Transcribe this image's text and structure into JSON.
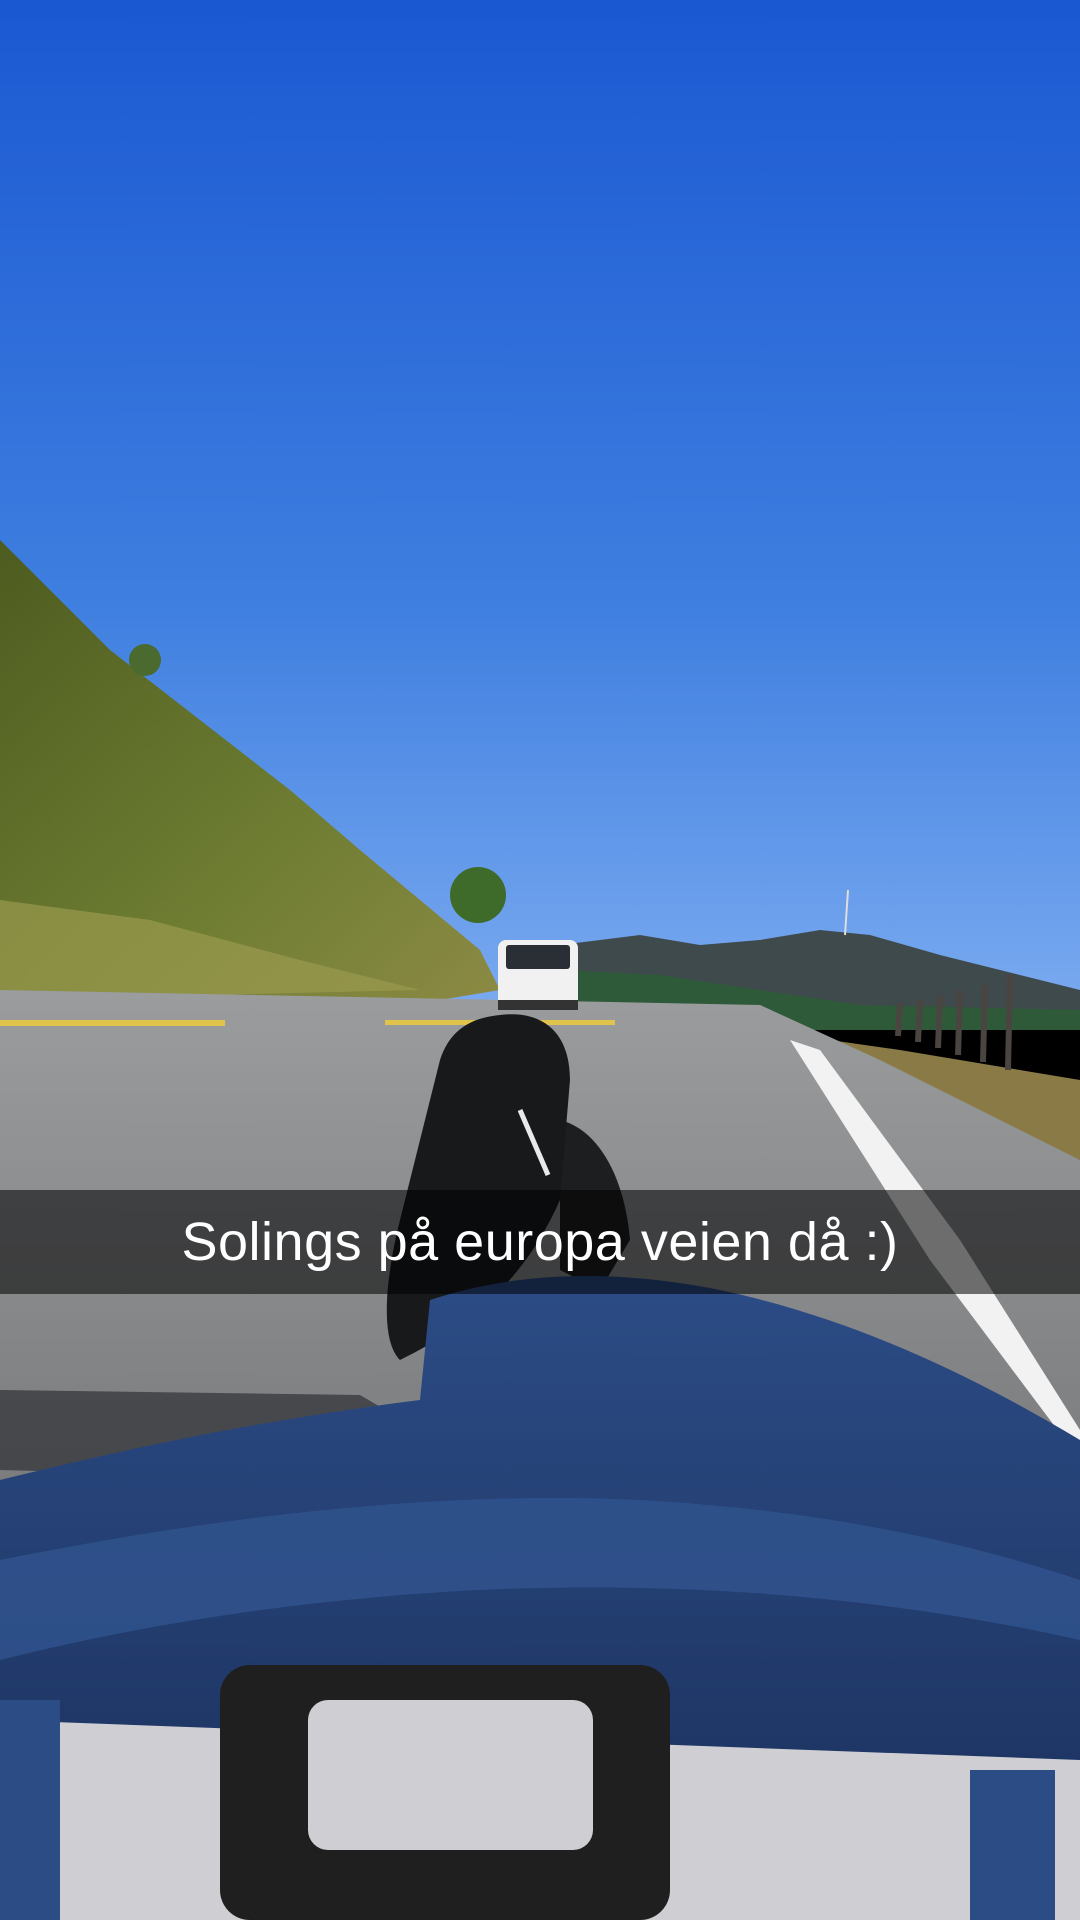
{
  "caption": {
    "text": "Solings på europa veien då :)"
  },
  "scene_colors": {
    "sky_top": "#1e5fd6",
    "sky_bottom": "#5f95e6",
    "hill": "#6b7a2e",
    "road": "#6f7173",
    "jeans": "#243f73",
    "shoe": "#1c1d1f"
  }
}
